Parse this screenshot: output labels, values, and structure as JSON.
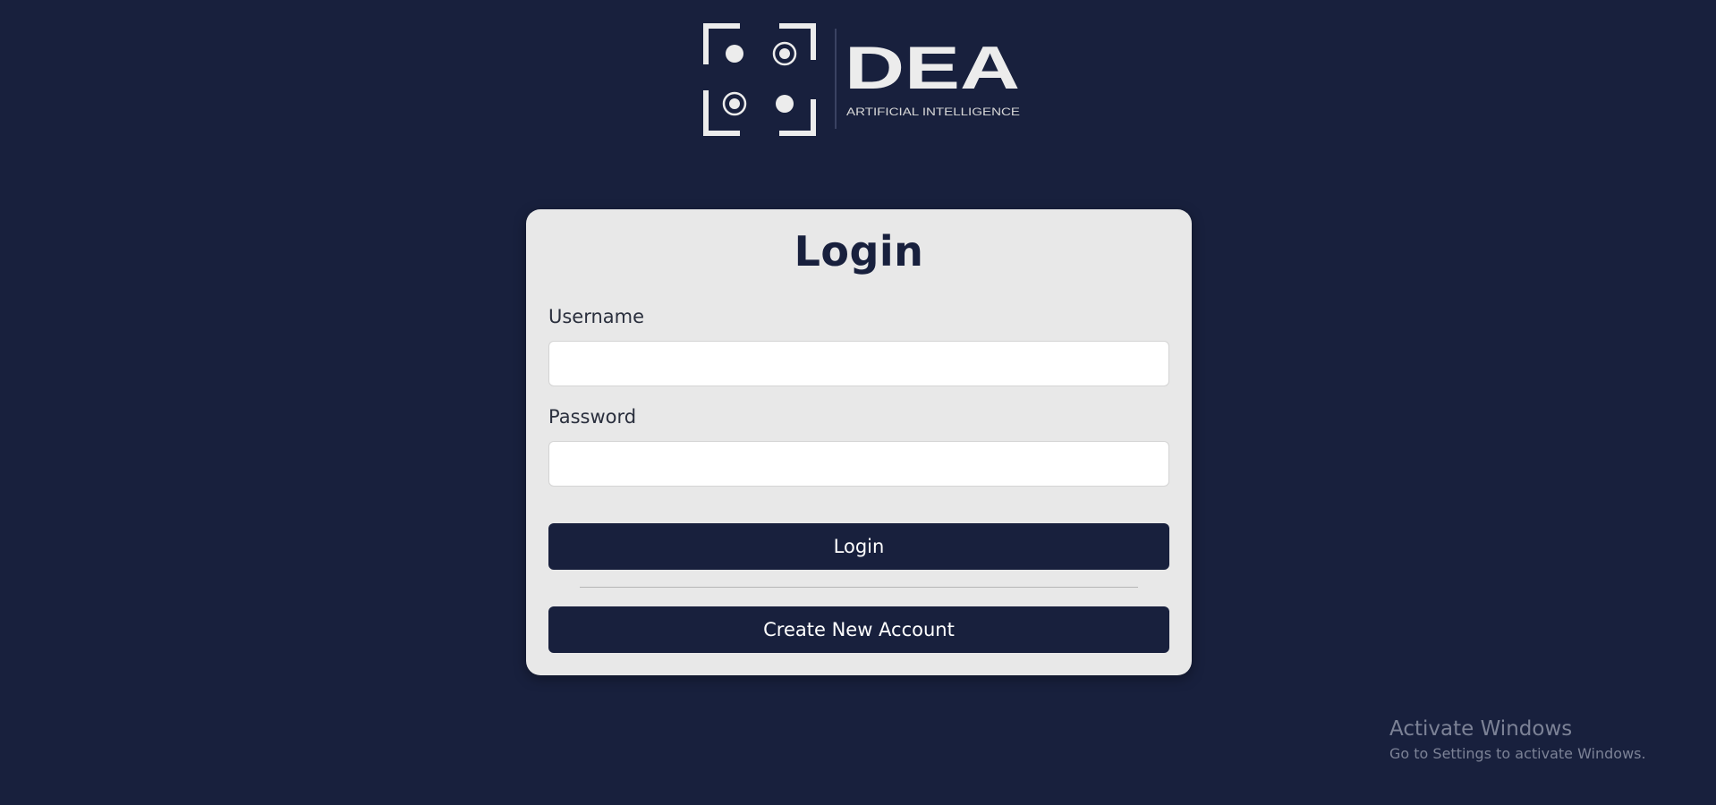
{
  "logo": {
    "wordmark": "DEA",
    "tagline": "ARTIFICIAL INTELLIGENCE",
    "icon": "face-scan-icon"
  },
  "login_card": {
    "title": "Login",
    "username_label": "Username",
    "username_value": "",
    "password_label": "Password",
    "password_value": "",
    "login_button_label": "Login",
    "create_account_button_label": "Create New Account"
  },
  "watermark": {
    "title": "Activate Windows",
    "subtitle": "Go to Settings to activate Windows."
  },
  "colors": {
    "background": "#18203d",
    "card": "#e8e8e8",
    "button": "#18203d",
    "button_text": "#ffffff",
    "logo": "#ececec"
  }
}
